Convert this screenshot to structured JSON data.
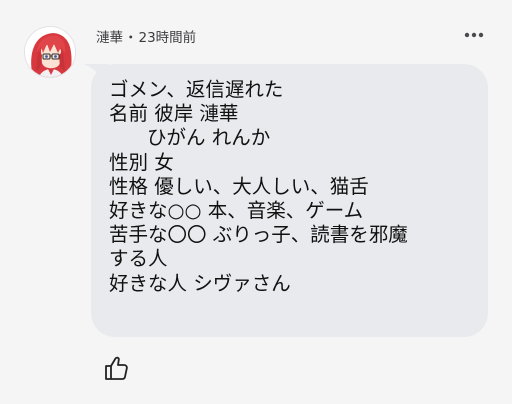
{
  "post": {
    "author": "漣華",
    "separator": "・",
    "time": "23時間前"
  },
  "message": {
    "lines": [
      "ゴメン、返信遅れた",
      "名前 彼岸 漣華",
      "ひがん れんか",
      "性別 女",
      "性格 優しい、大人しい、猫舌",
      "好きな○○  本、音楽、ゲーム",
      "苦手な〇〇 ぶりっ子、読書を邪魔",
      "する人",
      "好きな人 シヴァさん"
    ]
  },
  "icons": {
    "more": "more-dots-icon",
    "like": "thumbs-up-icon",
    "avatar": "anime-avatar"
  },
  "colors": {
    "background": "#f5f5f6",
    "bubble": "#e9eaee",
    "text": "#111111",
    "meta": "#3c3c40"
  }
}
